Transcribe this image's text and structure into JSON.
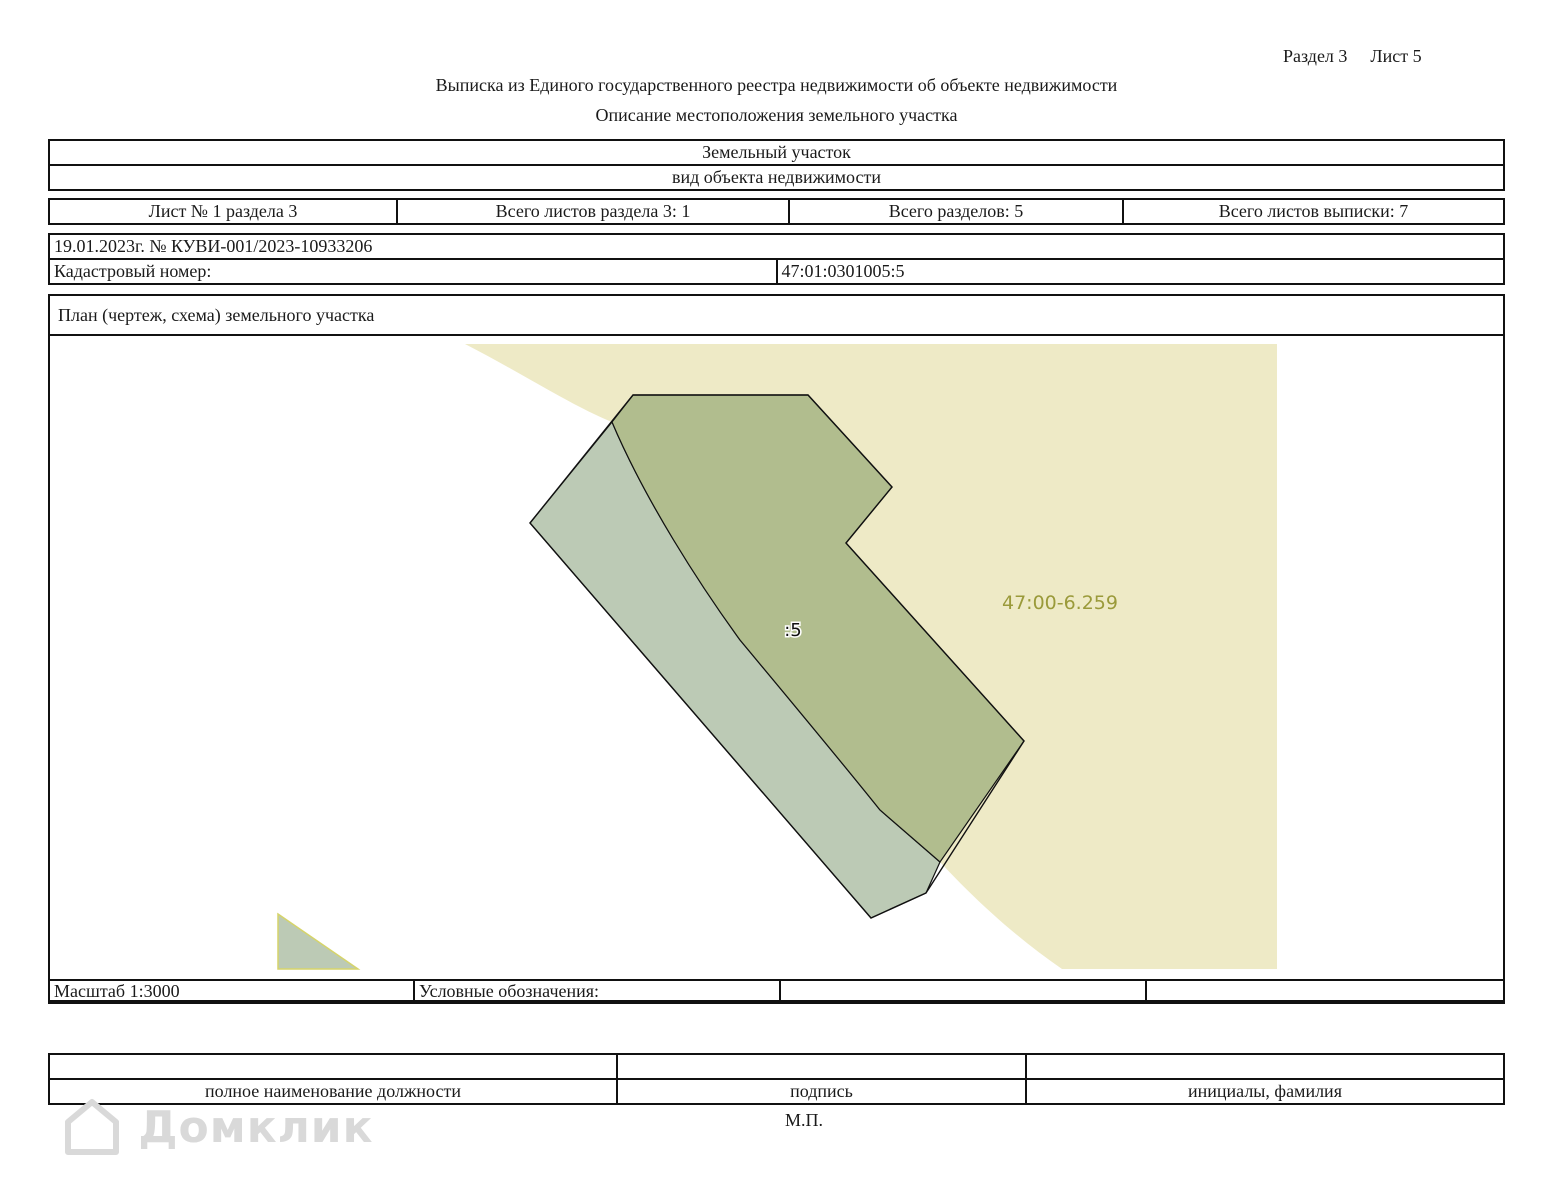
{
  "header": {
    "section_label": "Раздел 3",
    "sheet_label": "Лист 5",
    "title": "Выписка из Единого государственного реестра недвижимости об объекте недвижимости",
    "subtitle": "Описание местоположения земельного участка"
  },
  "object": {
    "type": "Земельный участок",
    "type_caption": "вид объекта недвижимости"
  },
  "sheets": {
    "sheet_of_section": "Лист № 1 раздела 3",
    "total_sheets_section": "Всего листов раздела 3: 1",
    "total_sections": "Всего разделов: 5",
    "total_sheets_extract": "Всего листов выписки: 7"
  },
  "info": {
    "date_number": "19.01.2023г. № КУВИ-001/2023-10933206",
    "cadastral_label": "Кадастровый номер:",
    "cadastral_value": "47:01:0301005:5"
  },
  "plan": {
    "title": "План (чертеж, схема) земельного участка",
    "parcel_label": ":5",
    "zone_label": "47:00-6.259",
    "colors": {
      "zone_fill": "#eeeac6",
      "parcel_fill": "#b1bd8e",
      "strip_fill": "#bccab5",
      "zone_label": "#9a9a3a"
    }
  },
  "scale_row": {
    "scale": "Масштаб 1:3000",
    "legend_label": "Условные обозначения:",
    "cell3": "",
    "cell4": ""
  },
  "signature": {
    "position_caption": "полное наименование должности",
    "signature_caption": "подпись",
    "name_caption": "инициалы, фамилия",
    "seal": "М.П."
  },
  "watermark": {
    "text": "Домклик",
    "icon": "house-logo-icon"
  }
}
